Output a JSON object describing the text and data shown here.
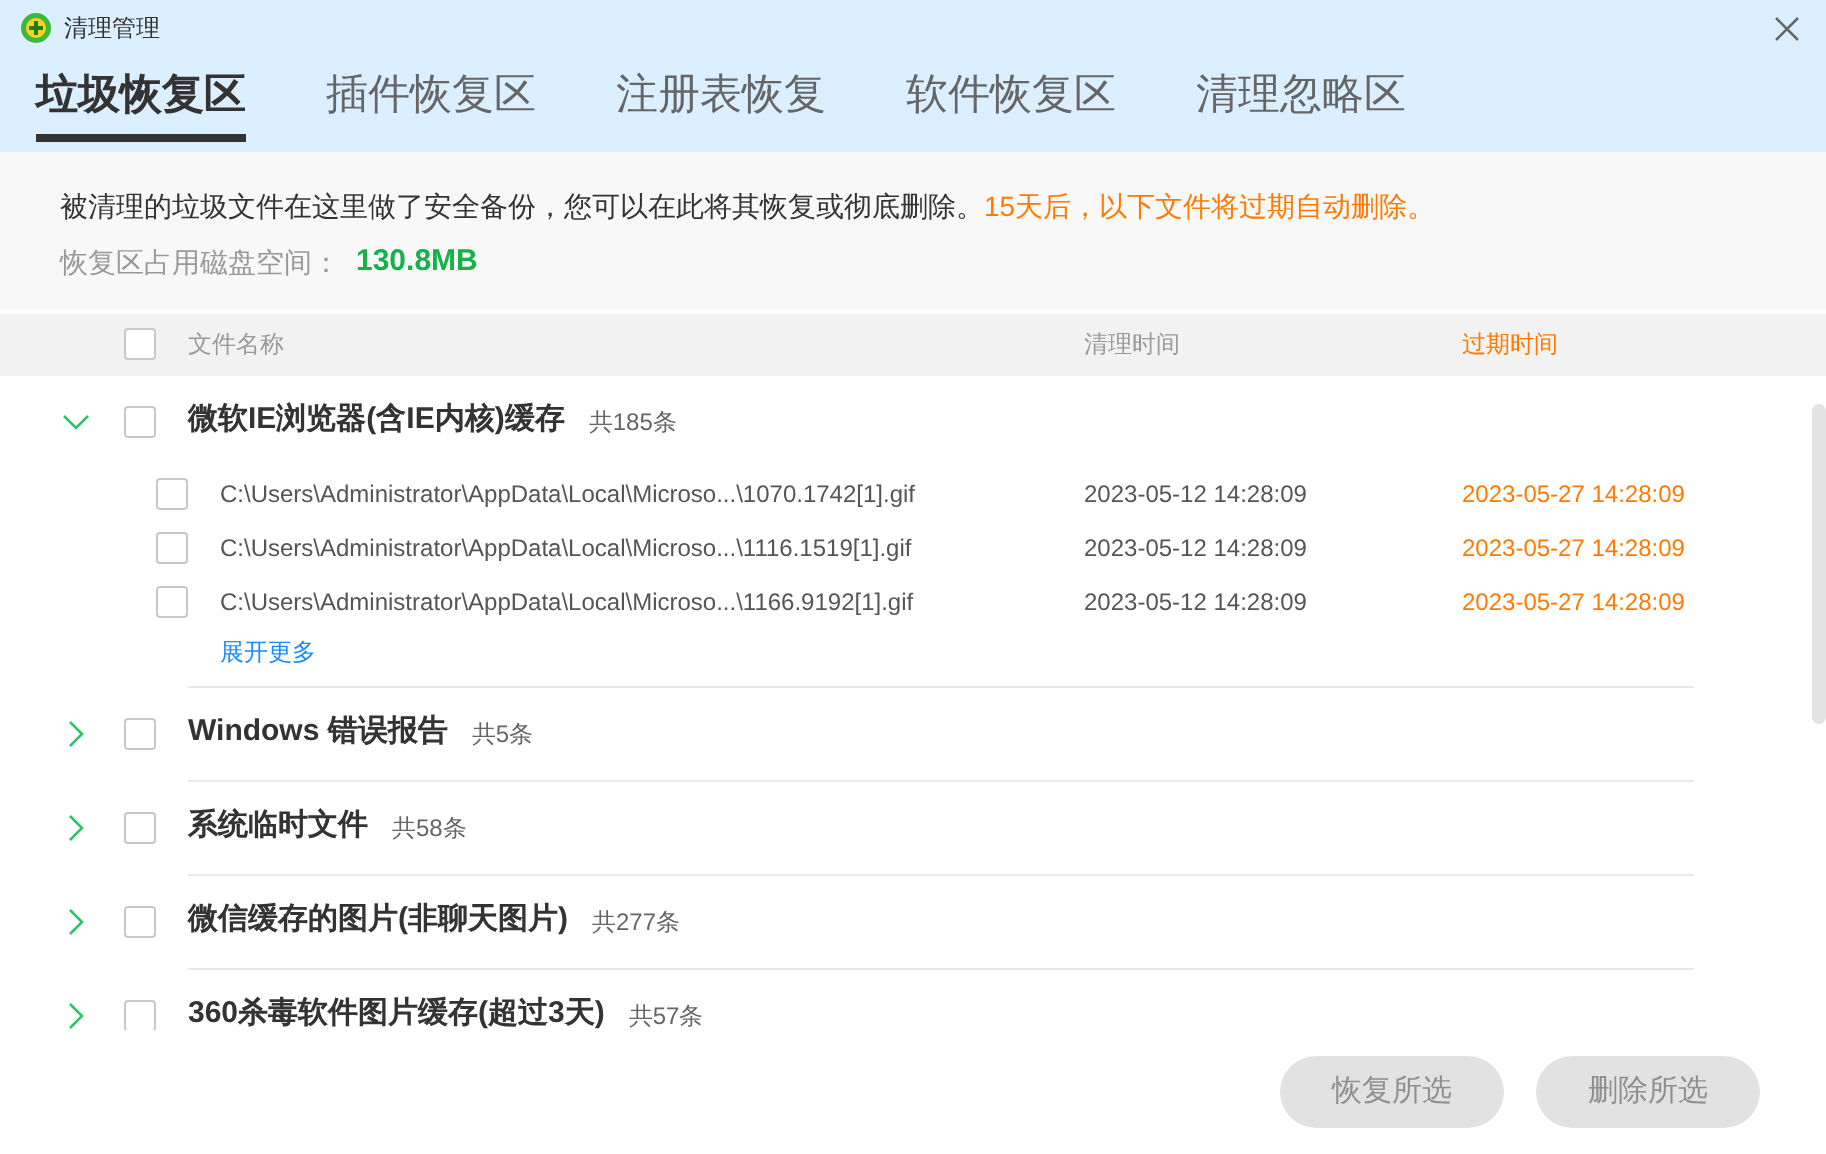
{
  "window": {
    "title": "清理管理"
  },
  "tabs": [
    {
      "label": "垃圾恢复区",
      "selected": true
    },
    {
      "label": "插件恢复区",
      "selected": false
    },
    {
      "label": "注册表恢复",
      "selected": false
    },
    {
      "label": "软件恢复区",
      "selected": false
    },
    {
      "label": "清理忽略区",
      "selected": false
    }
  ],
  "notice": {
    "text": "被清理的垃圾文件在这里做了安全备份，您可以在此将其恢复或彻底删除。",
    "warning": "15天后，以下文件将过期自动删除。",
    "disk_label": "恢复区占用磁盘空间：",
    "disk_value": "130.8MB"
  },
  "table": {
    "select_all_checked": false,
    "columns": [
      "文件名称",
      "清理时间",
      "过期时间"
    ],
    "groups": [
      {
        "name": "微软IE浏览器(含IE内核)缓存",
        "count": "共185条",
        "expanded": true,
        "checked": false,
        "files": [
          {
            "path": "C:\\Users\\Administrator\\AppData\\Local\\Microso...\\1070.1742[1].gif",
            "cleaned": "2023-05-12 14:28:09",
            "expires": "2023-05-27 14:28:09",
            "checked": false
          },
          {
            "path": "C:\\Users\\Administrator\\AppData\\Local\\Microso...\\1116.1519[1].gif",
            "cleaned": "2023-05-12 14:28:09",
            "expires": "2023-05-27 14:28:09",
            "checked": false
          },
          {
            "path": "C:\\Users\\Administrator\\AppData\\Local\\Microso...\\1166.9192[1].gif",
            "cleaned": "2023-05-12 14:28:09",
            "expires": "2023-05-27 14:28:09",
            "checked": false
          }
        ],
        "more": "展开更多"
      },
      {
        "name": "Windows 错误报告",
        "count": "共5条",
        "expanded": false,
        "checked": false
      },
      {
        "name": "系统临时文件",
        "count": "共58条",
        "expanded": false,
        "checked": false
      },
      {
        "name": "微信缓存的图片(非聊天图片)",
        "count": "共277条",
        "expanded": false,
        "checked": false
      },
      {
        "name": "360杀毒软件图片缓存(超过3天)",
        "count": "共57条",
        "expanded": false,
        "checked": false
      }
    ]
  },
  "buttons": [
    {
      "label": "恢复所选",
      "disabled": true
    },
    {
      "label": "删除所选",
      "disabled": true
    }
  ]
}
